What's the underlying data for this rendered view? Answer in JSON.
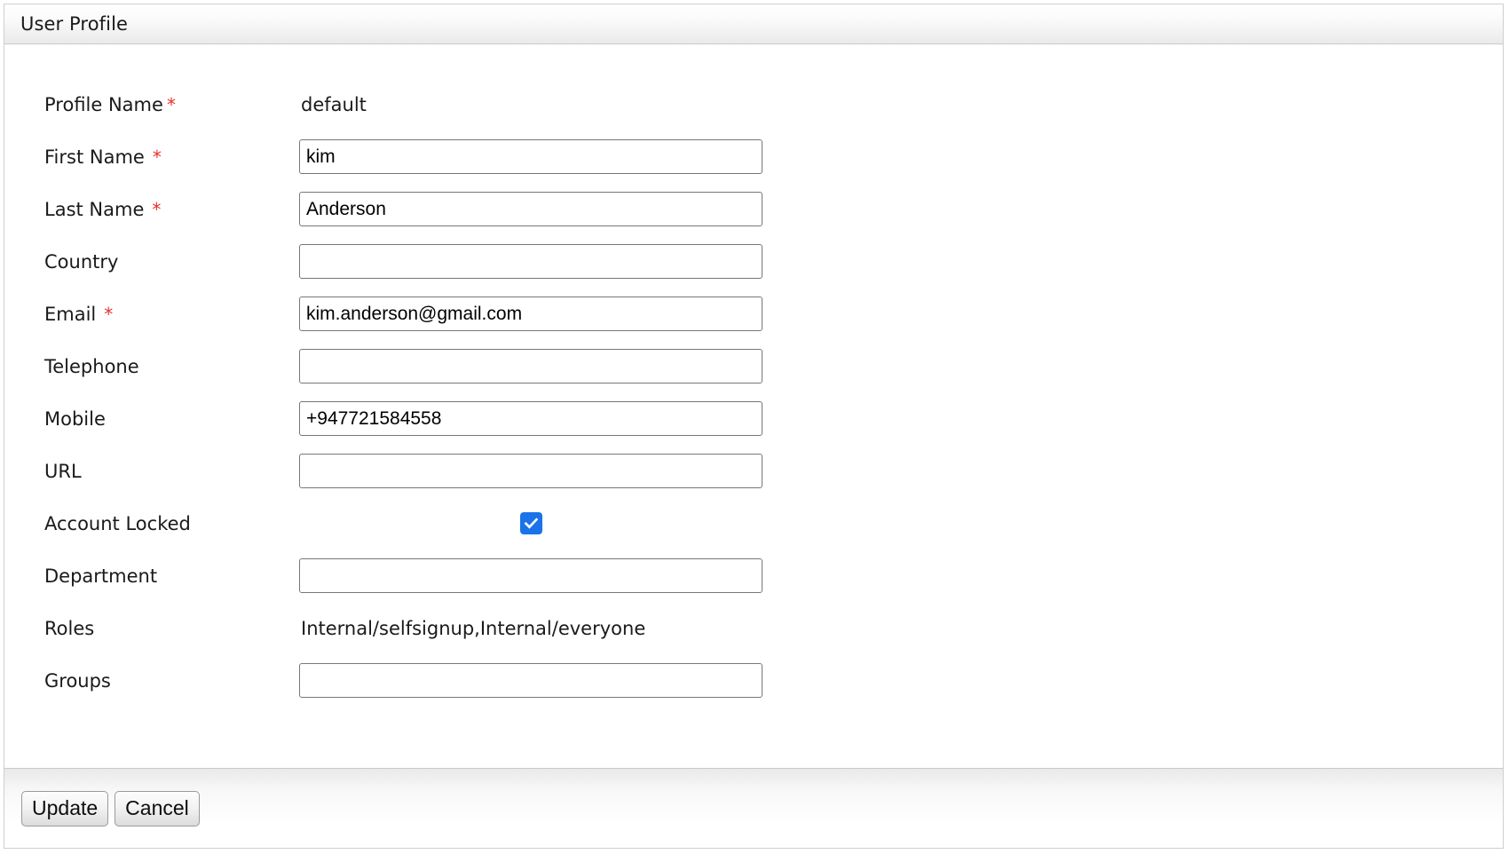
{
  "panel": {
    "title": "User Profile"
  },
  "form": {
    "rows": [
      {
        "label": "Profile Name",
        "required": true,
        "required_spaced": false,
        "type": "static",
        "value": "default",
        "name": "profile-name"
      },
      {
        "label": "First Name",
        "required": true,
        "required_spaced": true,
        "type": "input",
        "value": "kim",
        "placeholder": "",
        "name": "first-name"
      },
      {
        "label": "Last Name",
        "required": true,
        "required_spaced": true,
        "type": "input",
        "value": "Anderson",
        "placeholder": "",
        "name": "last-name"
      },
      {
        "label": "Country",
        "required": false,
        "required_spaced": false,
        "type": "input",
        "value": "",
        "placeholder": "",
        "name": "country"
      },
      {
        "label": "Email",
        "required": true,
        "required_spaced": true,
        "type": "input",
        "value": "kim.anderson@gmail.com",
        "placeholder": "",
        "name": "email"
      },
      {
        "label": "Telephone",
        "required": false,
        "required_spaced": false,
        "type": "input",
        "value": "",
        "placeholder": "",
        "name": "telephone"
      },
      {
        "label": "Mobile",
        "required": false,
        "required_spaced": false,
        "type": "input",
        "value": "+947721584558",
        "placeholder": "",
        "name": "mobile"
      },
      {
        "label": "URL",
        "required": false,
        "required_spaced": false,
        "type": "input",
        "value": "",
        "placeholder": "",
        "name": "url"
      },
      {
        "label": "Account Locked",
        "required": false,
        "required_spaced": false,
        "type": "checkbox",
        "checked": true,
        "name": "account-locked"
      },
      {
        "label": "Department",
        "required": false,
        "required_spaced": false,
        "type": "input",
        "value": "",
        "placeholder": "",
        "name": "department"
      },
      {
        "label": "Roles",
        "required": false,
        "required_spaced": false,
        "type": "static",
        "value": "Internal/selfsignup,Internal/everyone",
        "name": "roles"
      },
      {
        "label": "Groups",
        "required": false,
        "required_spaced": false,
        "type": "input",
        "value": "",
        "placeholder": "",
        "name": "groups"
      }
    ],
    "required_marker": "*"
  },
  "footer": {
    "update_label": "Update",
    "cancel_label": "Cancel"
  },
  "colors": {
    "required_asterisk": "#e8302a",
    "checkbox_checked": "#1a73e8",
    "input_border": "#777777",
    "panel_border": "#cfcfcf"
  }
}
